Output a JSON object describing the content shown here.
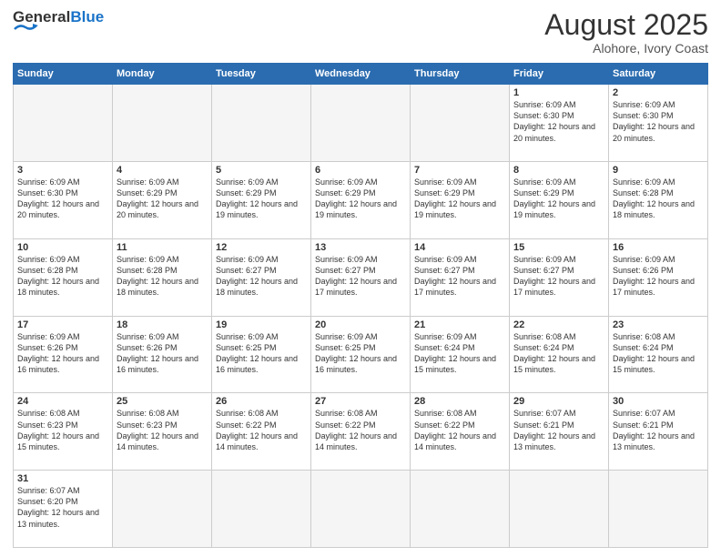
{
  "header": {
    "logo_general": "General",
    "logo_blue": "Blue",
    "month_title": "August 2025",
    "location": "Alohore, Ivory Coast"
  },
  "days_of_week": [
    "Sunday",
    "Monday",
    "Tuesday",
    "Wednesday",
    "Thursday",
    "Friday",
    "Saturday"
  ],
  "weeks": [
    [
      {
        "num": "",
        "info": ""
      },
      {
        "num": "",
        "info": ""
      },
      {
        "num": "",
        "info": ""
      },
      {
        "num": "",
        "info": ""
      },
      {
        "num": "",
        "info": ""
      },
      {
        "num": "1",
        "info": "Sunrise: 6:09 AM\nSunset: 6:30 PM\nDaylight: 12 hours and 20 minutes."
      },
      {
        "num": "2",
        "info": "Sunrise: 6:09 AM\nSunset: 6:30 PM\nDaylight: 12 hours and 20 minutes."
      }
    ],
    [
      {
        "num": "3",
        "info": "Sunrise: 6:09 AM\nSunset: 6:30 PM\nDaylight: 12 hours and 20 minutes."
      },
      {
        "num": "4",
        "info": "Sunrise: 6:09 AM\nSunset: 6:29 PM\nDaylight: 12 hours and 20 minutes."
      },
      {
        "num": "5",
        "info": "Sunrise: 6:09 AM\nSunset: 6:29 PM\nDaylight: 12 hours and 19 minutes."
      },
      {
        "num": "6",
        "info": "Sunrise: 6:09 AM\nSunset: 6:29 PM\nDaylight: 12 hours and 19 minutes."
      },
      {
        "num": "7",
        "info": "Sunrise: 6:09 AM\nSunset: 6:29 PM\nDaylight: 12 hours and 19 minutes."
      },
      {
        "num": "8",
        "info": "Sunrise: 6:09 AM\nSunset: 6:29 PM\nDaylight: 12 hours and 19 minutes."
      },
      {
        "num": "9",
        "info": "Sunrise: 6:09 AM\nSunset: 6:28 PM\nDaylight: 12 hours and 18 minutes."
      }
    ],
    [
      {
        "num": "10",
        "info": "Sunrise: 6:09 AM\nSunset: 6:28 PM\nDaylight: 12 hours and 18 minutes."
      },
      {
        "num": "11",
        "info": "Sunrise: 6:09 AM\nSunset: 6:28 PM\nDaylight: 12 hours and 18 minutes."
      },
      {
        "num": "12",
        "info": "Sunrise: 6:09 AM\nSunset: 6:27 PM\nDaylight: 12 hours and 18 minutes."
      },
      {
        "num": "13",
        "info": "Sunrise: 6:09 AM\nSunset: 6:27 PM\nDaylight: 12 hours and 17 minutes."
      },
      {
        "num": "14",
        "info": "Sunrise: 6:09 AM\nSunset: 6:27 PM\nDaylight: 12 hours and 17 minutes."
      },
      {
        "num": "15",
        "info": "Sunrise: 6:09 AM\nSunset: 6:27 PM\nDaylight: 12 hours and 17 minutes."
      },
      {
        "num": "16",
        "info": "Sunrise: 6:09 AM\nSunset: 6:26 PM\nDaylight: 12 hours and 17 minutes."
      }
    ],
    [
      {
        "num": "17",
        "info": "Sunrise: 6:09 AM\nSunset: 6:26 PM\nDaylight: 12 hours and 16 minutes."
      },
      {
        "num": "18",
        "info": "Sunrise: 6:09 AM\nSunset: 6:26 PM\nDaylight: 12 hours and 16 minutes."
      },
      {
        "num": "19",
        "info": "Sunrise: 6:09 AM\nSunset: 6:25 PM\nDaylight: 12 hours and 16 minutes."
      },
      {
        "num": "20",
        "info": "Sunrise: 6:09 AM\nSunset: 6:25 PM\nDaylight: 12 hours and 16 minutes."
      },
      {
        "num": "21",
        "info": "Sunrise: 6:09 AM\nSunset: 6:24 PM\nDaylight: 12 hours and 15 minutes."
      },
      {
        "num": "22",
        "info": "Sunrise: 6:08 AM\nSunset: 6:24 PM\nDaylight: 12 hours and 15 minutes."
      },
      {
        "num": "23",
        "info": "Sunrise: 6:08 AM\nSunset: 6:24 PM\nDaylight: 12 hours and 15 minutes."
      }
    ],
    [
      {
        "num": "24",
        "info": "Sunrise: 6:08 AM\nSunset: 6:23 PM\nDaylight: 12 hours and 15 minutes."
      },
      {
        "num": "25",
        "info": "Sunrise: 6:08 AM\nSunset: 6:23 PM\nDaylight: 12 hours and 14 minutes."
      },
      {
        "num": "26",
        "info": "Sunrise: 6:08 AM\nSunset: 6:22 PM\nDaylight: 12 hours and 14 minutes."
      },
      {
        "num": "27",
        "info": "Sunrise: 6:08 AM\nSunset: 6:22 PM\nDaylight: 12 hours and 14 minutes."
      },
      {
        "num": "28",
        "info": "Sunrise: 6:08 AM\nSunset: 6:22 PM\nDaylight: 12 hours and 14 minutes."
      },
      {
        "num": "29",
        "info": "Sunrise: 6:07 AM\nSunset: 6:21 PM\nDaylight: 12 hours and 13 minutes."
      },
      {
        "num": "30",
        "info": "Sunrise: 6:07 AM\nSunset: 6:21 PM\nDaylight: 12 hours and 13 minutes."
      }
    ],
    [
      {
        "num": "31",
        "info": "Sunrise: 6:07 AM\nSunset: 6:20 PM\nDaylight: 12 hours and 13 minutes."
      },
      {
        "num": "",
        "info": ""
      },
      {
        "num": "",
        "info": ""
      },
      {
        "num": "",
        "info": ""
      },
      {
        "num": "",
        "info": ""
      },
      {
        "num": "",
        "info": ""
      },
      {
        "num": "",
        "info": ""
      }
    ]
  ]
}
